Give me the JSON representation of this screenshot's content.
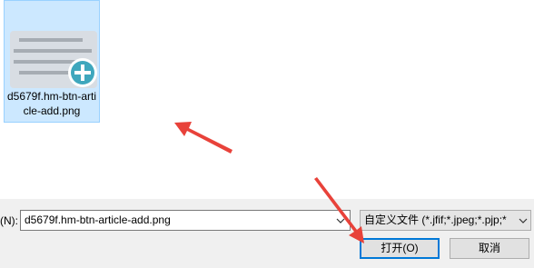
{
  "file_list": {
    "items": [
      {
        "name": "d5679f.hm-btn-article-add.png",
        "icon": "image-thumbnail-icon",
        "selected": true
      }
    ]
  },
  "filename": {
    "label": "(N):",
    "value": "d5679f.hm-btn-article-add.png"
  },
  "filetype": {
    "value": "自定义文件 (*.jfif;*.jpeg;*.pjp;*"
  },
  "buttons": {
    "open_label": "打开(O)",
    "cancel_label": "取消"
  },
  "colors": {
    "selection_bg": "#cce8ff",
    "selection_border": "#99d1ff",
    "annotation_arrow": "#e8423a",
    "accent_border": "#0078d7",
    "thumb_circle": "#3fa7bd"
  }
}
